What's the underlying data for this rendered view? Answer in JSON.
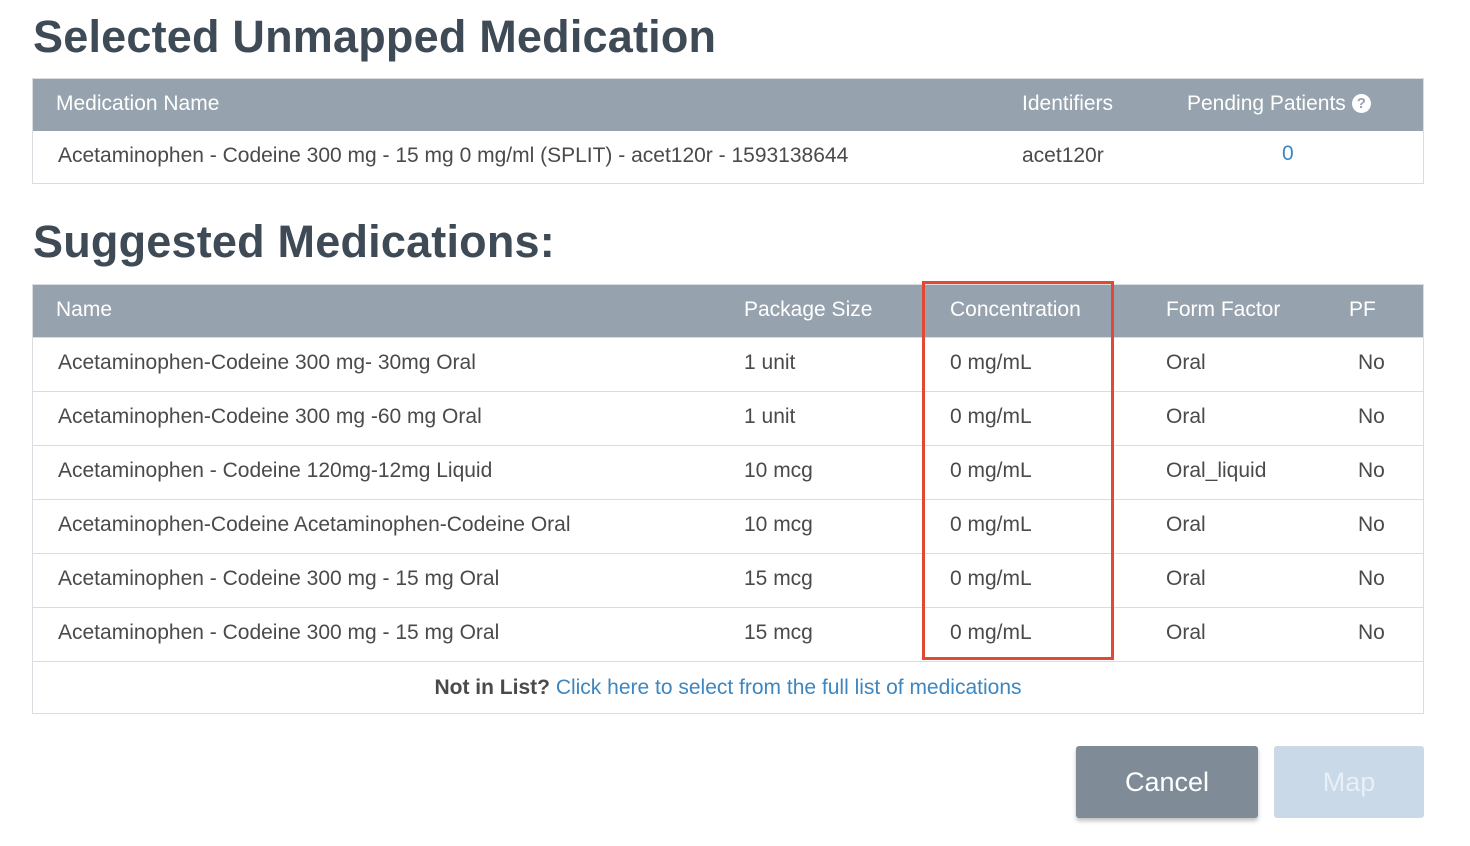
{
  "selected_section": {
    "title": "Selected Unmapped Medication",
    "columns": {
      "name": "Medication Name",
      "identifiers": "Identifiers",
      "pending": "Pending Patients"
    },
    "help_icon": "question-circle-icon",
    "row": {
      "name": "Acetaminophen - Codeine 300 mg - 15 mg 0 mg/ml (SPLIT) - acet120r - 1593138644",
      "identifiers": "acet120r",
      "pending": "0"
    }
  },
  "suggested_section": {
    "title": "Suggested Medications:",
    "columns": {
      "name": "Name",
      "package_size": "Package Size",
      "concentration": "Concentration",
      "form_factor": "Form Factor",
      "pf": "PF"
    },
    "rows": [
      {
        "name": "Acetaminophen-Codeine 300 mg- 30mg Oral",
        "package_size": "1 unit",
        "concentration": "0 mg/mL",
        "form_factor": "Oral",
        "pf": "No"
      },
      {
        "name": "Acetaminophen-Codeine 300 mg -60 mg Oral",
        "package_size": "1 unit",
        "concentration": "0 mg/mL",
        "form_factor": "Oral",
        "pf": "No"
      },
      {
        "name": "Acetaminophen - Codeine 120mg-12mg Liquid",
        "package_size": "10 mcg",
        "concentration": "0 mg/mL",
        "form_factor": "Oral_liquid",
        "pf": "No"
      },
      {
        "name": "Acetaminophen-Codeine Acetaminophen-Codeine Oral",
        "package_size": "10 mcg",
        "concentration": "0 mg/mL",
        "form_factor": "Oral",
        "pf": "No"
      },
      {
        "name": "Acetaminophen - Codeine 300 mg - 15 mg Oral",
        "package_size": "15 mcg",
        "concentration": "0 mg/mL",
        "form_factor": "Oral",
        "pf": "No"
      },
      {
        "name": "Acetaminophen - Codeine 300 mg - 15 mg Oral",
        "package_size": "15 mcg",
        "concentration": "0 mg/mL",
        "form_factor": "Oral",
        "pf": "No"
      }
    ],
    "footer": {
      "prompt": "Not in List?",
      "link": "Click here to select from the full list of medications"
    }
  },
  "buttons": {
    "cancel": "Cancel",
    "map": "Map"
  },
  "colors": {
    "header_bg": "#96a3ae",
    "title_text": "#3e4a55",
    "link": "#3d86bf",
    "highlight": "#e04a34",
    "cancel_bg": "#7f8c97",
    "map_disabled_bg": "#c9d9e8"
  }
}
